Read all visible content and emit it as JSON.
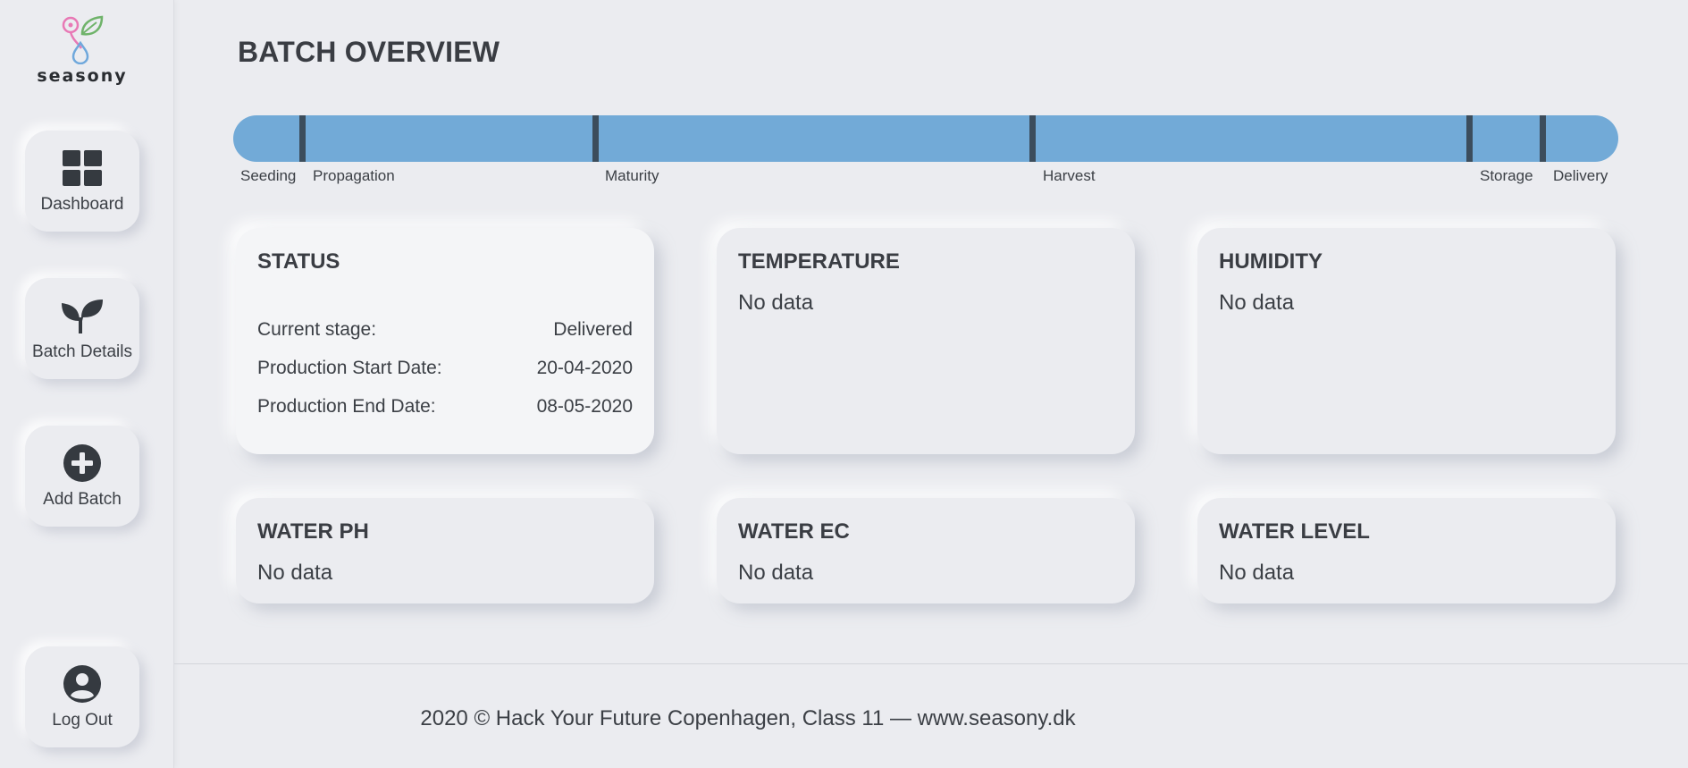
{
  "brand": {
    "name": "seasony"
  },
  "sidebar": {
    "items": [
      {
        "label": "Dashboard",
        "icon": "dashboard-grid-icon"
      },
      {
        "label": "Batch Details",
        "icon": "sprout-icon"
      },
      {
        "label": "Add Batch",
        "icon": "plus-circle-icon"
      },
      {
        "label": "Log Out",
        "icon": "user-circle-icon"
      }
    ]
  },
  "page": {
    "title": "BATCH OVERVIEW"
  },
  "timeline": {
    "bar_color": "#72aad7",
    "stages": [
      "Seeding",
      "Propagation",
      "Maturity",
      "Harvest",
      "Storage",
      "Delivery"
    ]
  },
  "status": {
    "title": "STATUS",
    "rows": [
      {
        "label": "Current stage:",
        "value": "Delivered"
      },
      {
        "label": "Production Start Date:",
        "value": "20-04-2020"
      },
      {
        "label": "Production End Date:",
        "value": "08-05-2020"
      }
    ]
  },
  "metrics": {
    "temperature": {
      "title": "TEMPERATURE",
      "value": "No data"
    },
    "humidity": {
      "title": "HUMIDITY",
      "value": "No data"
    },
    "water_ph": {
      "title": "WATER PH",
      "value": "No data"
    },
    "water_ec": {
      "title": "WATER EC",
      "value": "No data"
    },
    "water_level": {
      "title": "WATER LEVEL",
      "value": "No data"
    }
  },
  "footer": {
    "text": "2020 © Hack Your Future Copenhagen, Class 11 — www.seasony.dk"
  }
}
